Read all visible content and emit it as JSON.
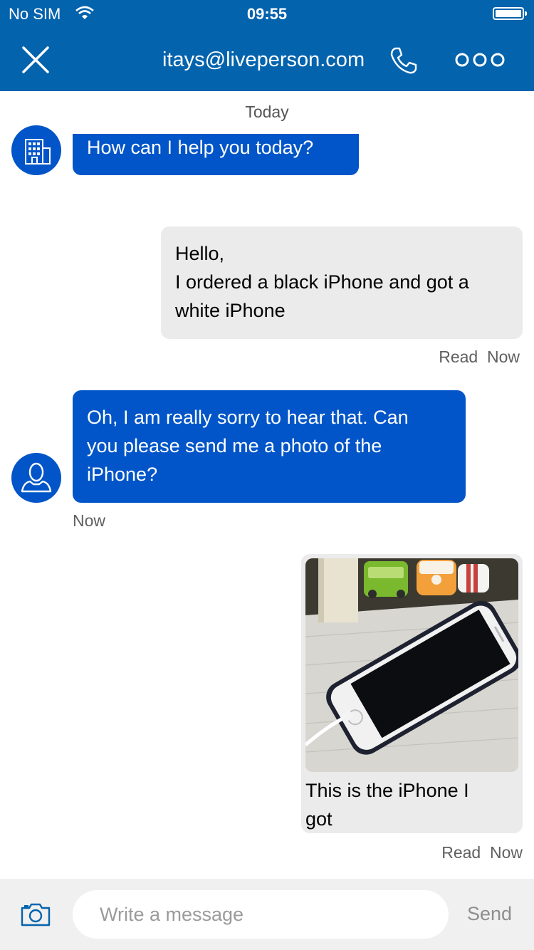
{
  "status_bar": {
    "carrier": "No SIM",
    "time": "09:55",
    "wifi_icon": "wifi-icon",
    "battery_icon": "battery-icon"
  },
  "header": {
    "title": "itays@liveperson.com",
    "close_icon": "close-icon",
    "phone_icon": "phone-icon",
    "more_icon": "more-icon",
    "background": "#0363ad"
  },
  "conversation": {
    "date_separator": "Today",
    "messages": [
      {
        "from": "agent",
        "avatar_icon": "building-icon",
        "lines": [
          "How can I help you today?"
        ]
      },
      {
        "from": "user",
        "lines": [
          "Hello,",
          "I ordered a black iPhone and got a",
          "white iPhone"
        ],
        "read_label": "Read",
        "time": "Now"
      },
      {
        "from": "agent",
        "avatar_icon": "user-icon",
        "lines": [
          "Oh, I am really sorry to hear that. Can",
          "you please send me a photo of the",
          "iPhone?"
        ],
        "time": "Now"
      },
      {
        "from": "user",
        "image": "iphone-photo",
        "caption_lines": [
          "This is the iPhone I",
          "got"
        ],
        "read_label": "Read",
        "time": "Now"
      }
    ],
    "agent_bubble_color": "#0155c8",
    "user_bubble_color": "#ebebeb"
  },
  "composer": {
    "camera_icon": "camera-icon",
    "placeholder": "Write a message",
    "send_label": "Send"
  }
}
